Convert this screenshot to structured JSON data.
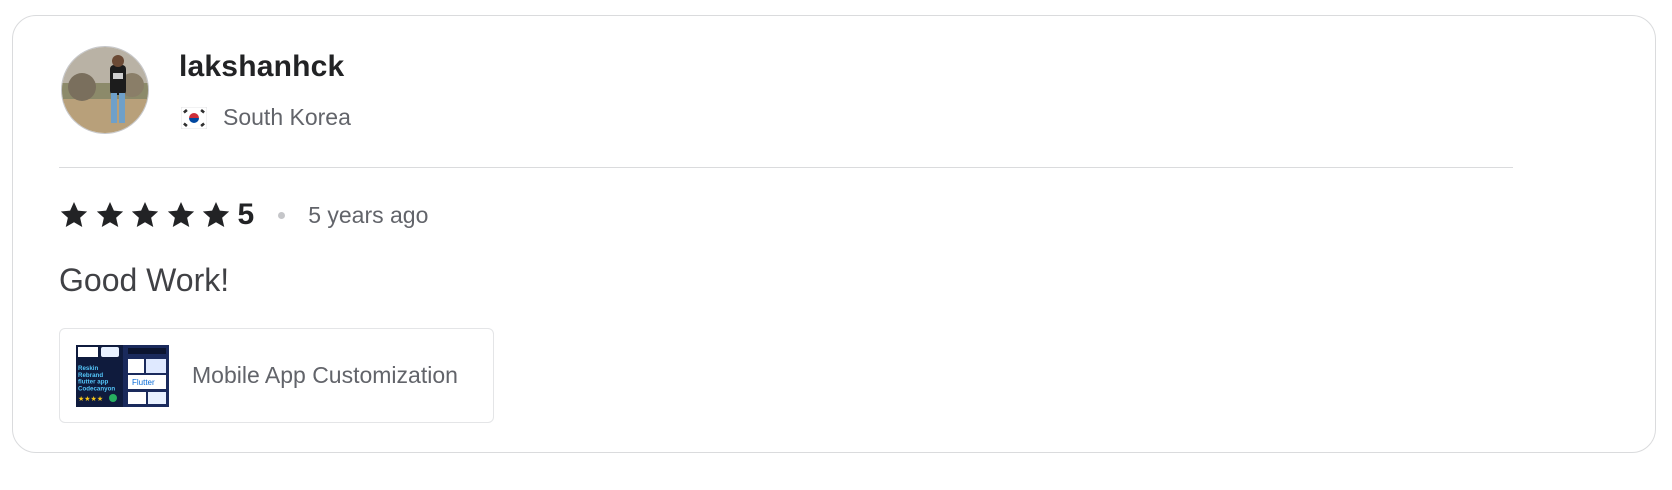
{
  "review": {
    "username": "lakshanhck",
    "country": "South Korea",
    "rating": "5",
    "star_count": 5,
    "time_ago": "5 years ago",
    "text": "Good Work!",
    "gig": {
      "title": "Mobile App Customization",
      "thumbnail_lines": [
        "Reskin",
        "Rebrand",
        "flutter app",
        "Codecanyon"
      ],
      "thumbnail_badge": "Flutter"
    }
  },
  "icons": {
    "avatar": "user-avatar-photo",
    "flag": "south-korea-flag-icon",
    "star": "star-icon"
  },
  "colors": {
    "star": "#222325",
    "muted_text": "#62646a",
    "border": "#dadbdd"
  }
}
